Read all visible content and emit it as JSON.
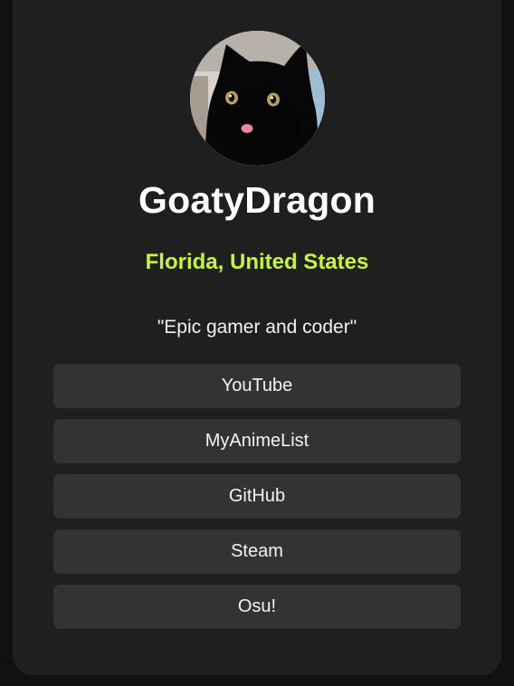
{
  "profile": {
    "name": "GoatyDragon",
    "location": "Florida, United States",
    "bio": "\"Epic gamer and coder\""
  },
  "links": [
    {
      "label": "YouTube"
    },
    {
      "label": "MyAnimeList"
    },
    {
      "label": "GitHub"
    },
    {
      "label": "Steam"
    },
    {
      "label": "Osu!"
    }
  ],
  "colors": {
    "page_background": "#111111",
    "card_background": "#1f1f1f",
    "button_background": "#333333",
    "accent": "#c7f33a",
    "text": "#ffffff"
  }
}
